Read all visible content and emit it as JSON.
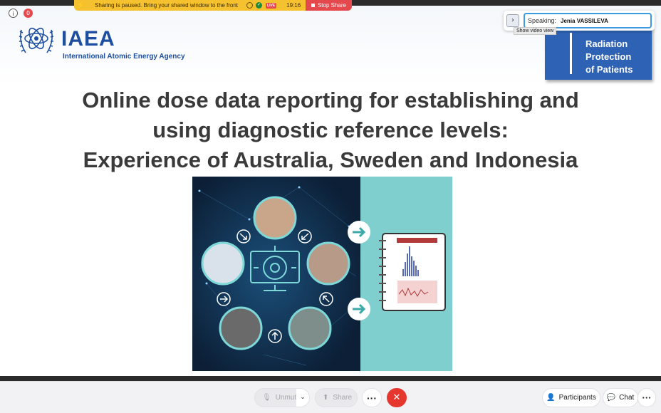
{
  "share_banner": {
    "message": "Sharing is paused. Bring your shared window to the front",
    "live_badge": "LIVE",
    "time": "19:16",
    "stop_label": "Stop Share"
  },
  "top_icons": {
    "info_icon": "info-icon",
    "recording_badge": "0"
  },
  "logo": {
    "name": "IAEA",
    "full_name": "International Atomic Energy Agency"
  },
  "rpop_box": {
    "line1": "Radiation",
    "line2": "Protection",
    "line3": "of Patients"
  },
  "speaker": {
    "label": "Speaking:",
    "name": "Jenia VASSILEVA",
    "expand_icon": "chevron-right-icon",
    "tooltip": "Show video view"
  },
  "slide": {
    "title_line1": "Online dose data reporting for establishing and",
    "title_line2": "using diagnostic reference levels:",
    "title_line3": "Experience of Australia, Sweden and Indonesia"
  },
  "toolbar": {
    "unmute_label": "Unmute",
    "share_label": "Share",
    "more_label": "···",
    "end_icon": "close-icon",
    "participants_label": "Participants",
    "chat_label": "Chat",
    "overflow_label": "···"
  },
  "colors": {
    "banner": "#f5c12e",
    "stop_share": "#e5484d",
    "iaea_blue": "#1e4ea0",
    "rpop_blue": "#2e62b5",
    "end_call": "#e5372e",
    "illus_dark": "#0f2a45",
    "illus_teal": "#7fcfcf"
  }
}
